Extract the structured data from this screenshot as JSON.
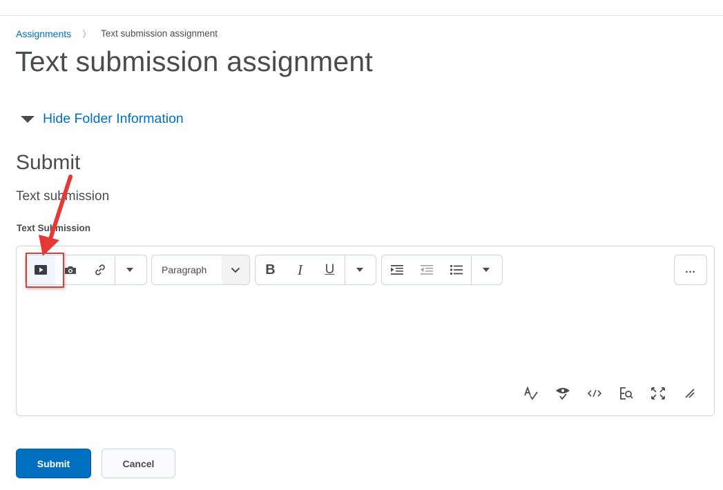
{
  "breadcrumb": {
    "parent": "Assignments",
    "separator": "〉",
    "current": "Text submission assignment"
  },
  "page": {
    "title": "Text submission assignment"
  },
  "folder_toggle": {
    "label": "Hide Folder Information"
  },
  "submit_section": {
    "title": "Submit",
    "subtitle": "Text submission",
    "field_label": "Text Submission"
  },
  "editor": {
    "toolbar": {
      "insert_group": [
        "insert-media-icon",
        "insert-image-icon",
        "insert-link-icon",
        "chevron-down-icon"
      ],
      "format_select": {
        "selected": "Paragraph"
      },
      "text_style_group": {
        "bold": "B",
        "italic": "I",
        "underline": "U"
      },
      "alignment_group": [
        "indent-icon",
        "outdent-icon",
        "bullet-list-icon",
        "chevron-down-icon"
      ],
      "more": "…"
    },
    "bottom_tools": [
      "spellcheck-icon",
      "accessibility-check-icon",
      "source-code-icon",
      "find-replace-icon",
      "fullscreen-icon",
      "resize-handle-icon"
    ]
  },
  "actions": {
    "submit_label": "Submit",
    "cancel_label": "Cancel"
  },
  "colors": {
    "accent": "#006fbf",
    "annotation": "#e53935",
    "text": "#494c4e",
    "border": "#cdd5dc"
  }
}
